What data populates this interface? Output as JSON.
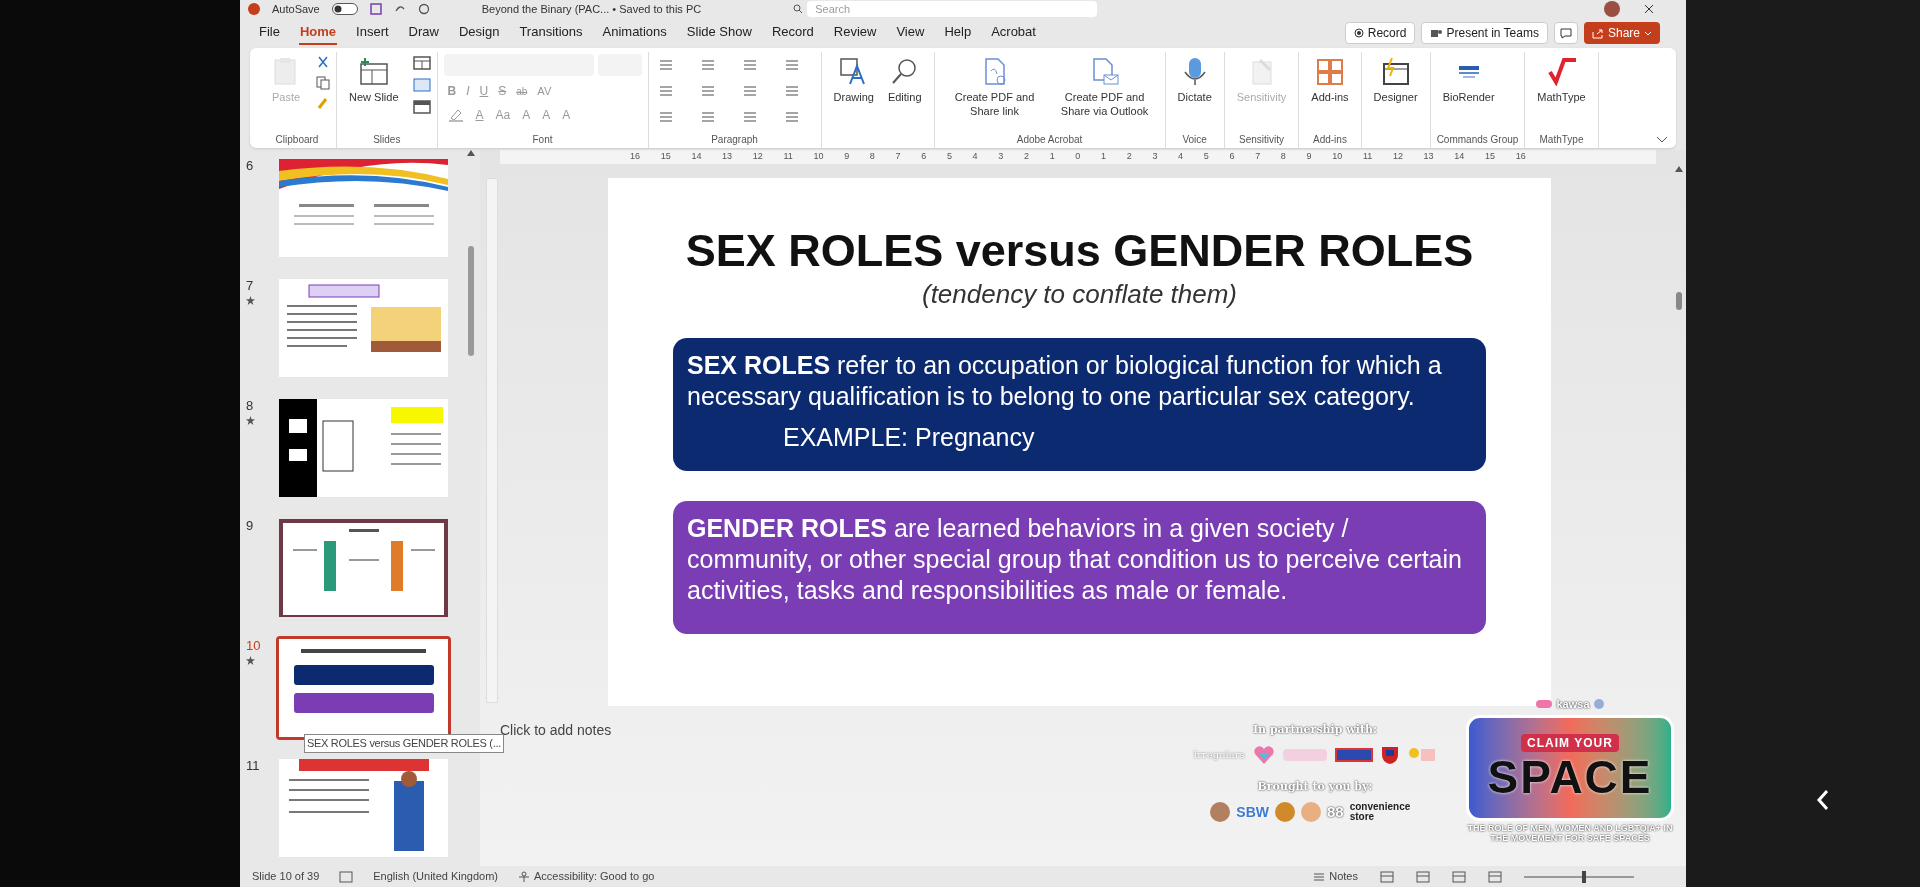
{
  "title_bar": {
    "autosave": "AutoSave",
    "document": "Beyond the Binary (PAC... • Saved to this PC",
    "search_placeholder": "Search"
  },
  "tabs": [
    {
      "label": "File",
      "selected": false
    },
    {
      "label": "Home",
      "selected": true
    },
    {
      "label": "Insert",
      "selected": false
    },
    {
      "label": "Draw",
      "selected": false
    },
    {
      "label": "Design",
      "selected": false
    },
    {
      "label": "Transitions",
      "selected": false
    },
    {
      "label": "Animations",
      "selected": false
    },
    {
      "label": "Slide Show",
      "selected": false
    },
    {
      "label": "Record",
      "selected": false
    },
    {
      "label": "Review",
      "selected": false
    },
    {
      "label": "View",
      "selected": false
    },
    {
      "label": "Help",
      "selected": false
    },
    {
      "label": "Acrobat",
      "selected": false
    }
  ],
  "header_buttons": {
    "record": "Record",
    "present": "Present in Teams",
    "share": "Share"
  },
  "ribbon": [
    {
      "kind": "clipboard",
      "label": "Clipboard",
      "buttons": [
        {
          "label": "Paste",
          "disabled": true
        }
      ]
    },
    {
      "kind": "slides",
      "label": "Slides",
      "buttons": [
        {
          "label": "New Slide",
          "disabled": false
        }
      ]
    },
    {
      "kind": "font",
      "label": "Font",
      "row1": [
        "B",
        "I",
        "U",
        "S",
        "ab",
        "AV"
      ],
      "row2": [
        "A",
        "Aa",
        "A",
        "A",
        "A"
      ]
    },
    {
      "kind": "paragraph",
      "label": "Paragraph"
    },
    {
      "kind": "large",
      "buttons": [
        {
          "label": "Drawing",
          "disabled": false
        },
        {
          "label": "Editing",
          "disabled": false
        }
      ]
    },
    {
      "kind": "large",
      "label": "Adobe Acrobat",
      "buttons": [
        {
          "label": "Create PDF and Share link",
          "disabled": false
        },
        {
          "label": "Create PDF and Share via Outlook",
          "disabled": false
        }
      ]
    },
    {
      "kind": "large",
      "label": "Voice",
      "buttons": [
        {
          "label": "Dictate",
          "disabled": false
        }
      ]
    },
    {
      "kind": "large",
      "label": "Sensitivity",
      "buttons": [
        {
          "label": "Sensitivity",
          "disabled": true
        }
      ]
    },
    {
      "kind": "large",
      "label": "Add-ins",
      "buttons": [
        {
          "label": "Add-ins",
          "disabled": false
        }
      ]
    },
    {
      "kind": "large",
      "buttons": [
        {
          "label": "Designer",
          "disabled": false
        }
      ]
    },
    {
      "kind": "large",
      "label": "Commands Group",
      "buttons": [
        {
          "label": "BioRender",
          "disabled": false
        }
      ]
    },
    {
      "kind": "large",
      "label": "MathType",
      "buttons": [
        {
          "label": "MathType",
          "disabled": false
        }
      ]
    }
  ],
  "ruler_labels": [
    "16",
    "15",
    "14",
    "13",
    "12",
    "11",
    "10",
    "9",
    "8",
    "7",
    "6",
    "5",
    "4",
    "3",
    "2",
    "1",
    "0",
    "1",
    "2",
    "3",
    "4",
    "5",
    "6",
    "7",
    "8",
    "9",
    "10",
    "11",
    "12",
    "13",
    "14",
    "15",
    "16"
  ],
  "thumbnails": [
    {
      "number": "6",
      "starred": false,
      "selected": false
    },
    {
      "number": "7",
      "starred": true,
      "selected": false
    },
    {
      "number": "8",
      "starred": true,
      "selected": false
    },
    {
      "number": "9",
      "starred": false,
      "selected": false
    },
    {
      "number": "10",
      "starred": true,
      "selected": true
    },
    {
      "number": "11",
      "starred": false,
      "selected": false
    }
  ],
  "tooltip": "SEX ROLES versus GENDER ROLES (...",
  "slide": {
    "title": "SEX ROLES versus GENDER ROLES",
    "subtitle": "(tendency to conflate them)",
    "boxes": [
      {
        "color": "#0b2a70",
        "text": "**SEX ROLES** refer to an occupation or biological function for which a necessary qualification is to belong to one particular sex category.",
        "example": "EXAMPLE: Pregnancy"
      },
      {
        "color": "#7a3db3",
        "text": "**GENDER ROLES** are learned behaviors in a given society / community, or other special group that condition us to perceive certain activities, tasks and responsibilities as male or female."
      }
    ]
  },
  "notes_placeholder": "Click to add notes",
  "status_bar": {
    "slide": "Slide 10 of 39",
    "language": "English (United Kingdom)",
    "accessibility": "Accessibility: Good to go",
    "notes": "Notes",
    "zoom": {
      "level": 0.55
    }
  },
  "overlay": {
    "partnership": "In partnership with:",
    "partner_text": "Irregulars",
    "brought": "Brought to you by:",
    "sponsor_text": "SBW",
    "sponsor_number": "88",
    "sponsor_caption": "convenience store",
    "org": "kawsa",
    "claim": "CLAIM YOUR",
    "space": "SPACE",
    "tagline": "THE ROLE OF MEN, WOMEN  AND LGBTQIA+ IN THE MOVEMENT FOR SAFE SPACES"
  }
}
